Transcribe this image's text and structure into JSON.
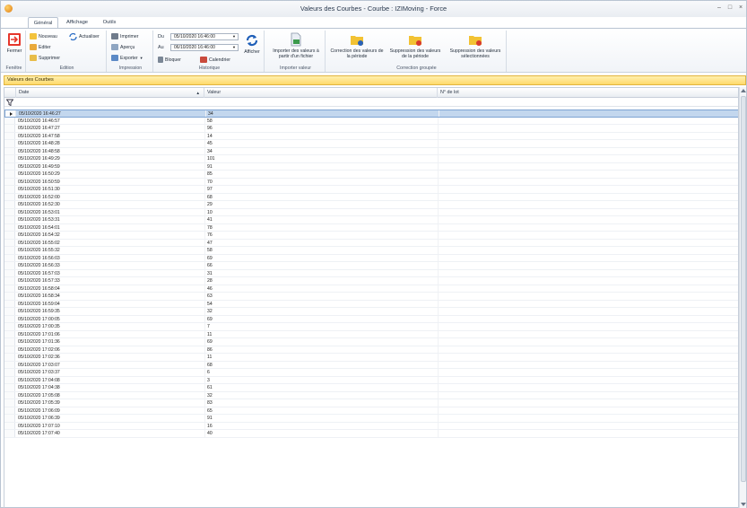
{
  "window": {
    "title": "Valeurs des Courbes - Courbe : IZIMoving - Force",
    "min": "–",
    "max": "□",
    "close": "×"
  },
  "tabs": [
    "Général",
    "Affichage",
    "Outils"
  ],
  "ribbon": {
    "fenetre": {
      "label": "Fenêtre",
      "fermer": "Fermer"
    },
    "edition": {
      "label": "Edition",
      "nouveau": "Nouveau",
      "editer": "Editer",
      "supprimer": "Supprimer",
      "actualiser": "Actualiser"
    },
    "impression": {
      "label": "Impression",
      "imprimer": "Imprimer",
      "apercu": "Aperçu",
      "exporter": "Exporter"
    },
    "historique": {
      "label": "Historique",
      "du_label": "Du",
      "au_label": "Au",
      "du_value": "05/10/2020 16:46:00",
      "au_value": "06/10/2020 16:46:00",
      "bloquer": "Bloquer",
      "calendrier": "Calendrier",
      "afficher": "Afficher"
    },
    "importer": {
      "label": "Importer valeur",
      "button": "Importer des valeurs à partir d'un fichier"
    },
    "correction": {
      "label": "Correction groupée",
      "periode": "Correction des valeurs de la période",
      "suppression_periode": "Suppression des valeurs de la période",
      "suppression_selection": "Suppression des valeurs sélectionnées"
    }
  },
  "group_header": "Valeurs des Courbes",
  "columns": [
    "Date",
    "Valeur",
    "N° de lot"
  ],
  "rows": [
    [
      "05/10/2020 16:46:27",
      "34"
    ],
    [
      "05/10/2020 16:46:57",
      "58"
    ],
    [
      "05/10/2020 16:47:27",
      "96"
    ],
    [
      "05/10/2020 16:47:58",
      "14"
    ],
    [
      "05/10/2020 16:48:28",
      "45"
    ],
    [
      "05/10/2020 16:48:58",
      "34"
    ],
    [
      "05/10/2020 16:49:29",
      "101"
    ],
    [
      "05/10/2020 16:49:59",
      "91"
    ],
    [
      "05/10/2020 16:50:29",
      "85"
    ],
    [
      "05/10/2020 16:50:59",
      "70"
    ],
    [
      "05/10/2020 16:51:30",
      "97"
    ],
    [
      "05/10/2020 16:52:00",
      "68"
    ],
    [
      "05/10/2020 16:52:30",
      "29"
    ],
    [
      "05/10/2020 16:53:01",
      "10"
    ],
    [
      "05/10/2020 16:53:31",
      "41"
    ],
    [
      "05/10/2020 16:54:01",
      "78"
    ],
    [
      "05/10/2020 16:54:32",
      "76"
    ],
    [
      "05/10/2020 16:55:02",
      "47"
    ],
    [
      "05/10/2020 16:55:32",
      "58"
    ],
    [
      "05/10/2020 16:56:03",
      "69"
    ],
    [
      "05/10/2020 16:56:33",
      "66"
    ],
    [
      "05/10/2020 16:57:03",
      "31"
    ],
    [
      "05/10/2020 16:57:33",
      "28"
    ],
    [
      "05/10/2020 16:58:04",
      "46"
    ],
    [
      "05/10/2020 16:58:34",
      "63"
    ],
    [
      "05/10/2020 16:59:04",
      "54"
    ],
    [
      "05/10/2020 16:59:35",
      "32"
    ],
    [
      "05/10/2020 17:00:05",
      "69"
    ],
    [
      "05/10/2020 17:00:35",
      "7"
    ],
    [
      "05/10/2020 17:01:06",
      "11"
    ],
    [
      "05/10/2020 17:01:36",
      "69"
    ],
    [
      "05/10/2020 17:02:06",
      "86"
    ],
    [
      "05/10/2020 17:02:36",
      "11"
    ],
    [
      "05/10/2020 17:03:07",
      "68"
    ],
    [
      "05/10/2020 17:03:37",
      "6"
    ],
    [
      "05/10/2020 17:04:08",
      "3"
    ],
    [
      "05/10/2020 17:04:38",
      "61"
    ],
    [
      "05/10/2020 17:05:08",
      "32"
    ],
    [
      "05/10/2020 17:05:39",
      "83"
    ],
    [
      "05/10/2020 17:06:09",
      "65"
    ],
    [
      "05/10/2020 17:06:39",
      "91"
    ],
    [
      "05/10/2020 17:07:10",
      "16"
    ],
    [
      "05/10/2020 17:07:40",
      "40"
    ]
  ]
}
